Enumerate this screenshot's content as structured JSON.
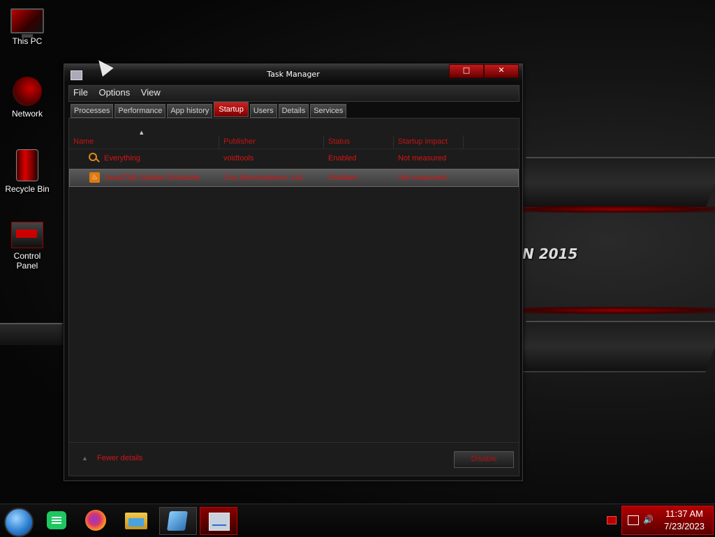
{
  "desktop": {
    "icons": [
      {
        "label": "This PC"
      },
      {
        "label": "Network"
      },
      {
        "label": "Recycle Bin"
      },
      {
        "label": "Control Panel"
      }
    ],
    "wallpaper_text": "N 2015"
  },
  "window": {
    "title": "Task Manager",
    "controls": {
      "restore": "□",
      "close": "✕"
    },
    "menu": [
      "File",
      "Options",
      "View"
    ],
    "tabs": [
      "Processes",
      "Performance",
      "App history",
      "Startup",
      "Users",
      "Details",
      "Services"
    ],
    "active_tab": "Startup",
    "columns": [
      "Name",
      "Publisher",
      "Status",
      "Startup impact"
    ],
    "rows": [
      {
        "name": "Everything",
        "publisher": "voidtools",
        "status": "Enabled",
        "impact": "Not measured",
        "icon": "search-icon"
      },
      {
        "name": "Java(TM) Update Scheduler",
        "publisher": "Sun Microsystems, Ltd.",
        "status": "Enabled",
        "impact": "Not measured",
        "icon": "java-icon"
      }
    ],
    "footer": {
      "fewer_details": "Fewer details",
      "disable": "Disable"
    }
  },
  "taskbar": {
    "apps": [
      "start-orb-icon",
      "notes-icon",
      "firefox-icon",
      "file-explorer-icon",
      "visual-studio-icon",
      "task-manager-icon"
    ],
    "clock": {
      "time": "11:37 AM",
      "date": "7/23/2023"
    }
  },
  "colors": {
    "accent": "#d51414",
    "window_bg": "#1c1c1c",
    "tray": "#b00000"
  }
}
